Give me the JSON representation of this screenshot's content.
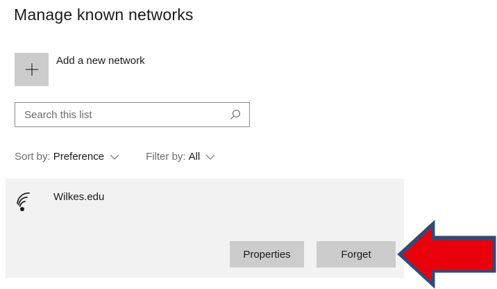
{
  "page": {
    "title": "Manage known networks"
  },
  "add_network": {
    "icon": "plus-icon",
    "label": "Add a new network"
  },
  "search": {
    "placeholder": "Search this list",
    "value": "",
    "icon": "search-icon"
  },
  "sort": {
    "prefix": "Sort by:",
    "value": "Preference"
  },
  "filter": {
    "prefix": "Filter by:",
    "value": "All"
  },
  "networks": [
    {
      "name": "Wilkes.edu",
      "icon": "wifi-icon",
      "actions": {
        "properties_label": "Properties",
        "forget_label": "Forget"
      }
    }
  ],
  "annotation": {
    "icon": "red-arrow-icon",
    "fill_color": "#e8000b",
    "border_color": "#2f4a7a"
  }
}
